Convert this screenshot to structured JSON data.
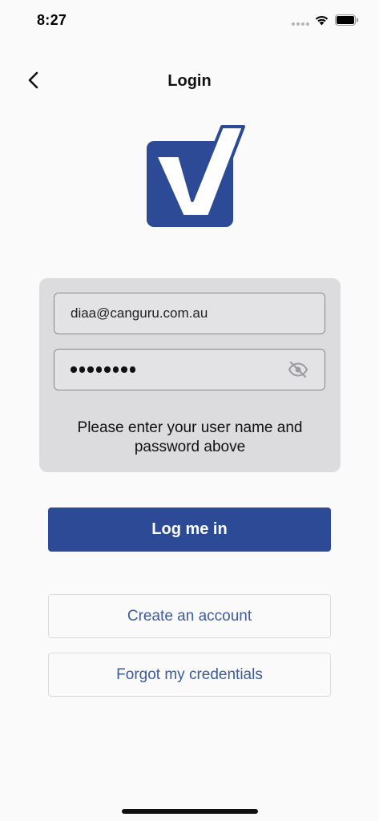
{
  "status_bar": {
    "time": "8:27",
    "wifi_icon": "wifi-icon",
    "battery_icon": "battery-icon"
  },
  "nav": {
    "title": "Login",
    "back_icon": "chevron-left-icon"
  },
  "logo": {
    "icon": "checkmark-logo-icon",
    "color": "#2d4a96"
  },
  "form": {
    "email_value": "diaa@canguru.com.au",
    "password_mask_length": 8,
    "password_toggle_icon": "eye-slash-icon",
    "hint": "Please enter your user name and password above"
  },
  "buttons": {
    "login": "Log me in",
    "create_account": "Create an account",
    "forgot": "Forgot my credentials"
  },
  "colors": {
    "primary": "#2d4a96",
    "link": "#3d5a9c",
    "card_bg": "#dcdcde",
    "page_bg": "#fafafa"
  }
}
